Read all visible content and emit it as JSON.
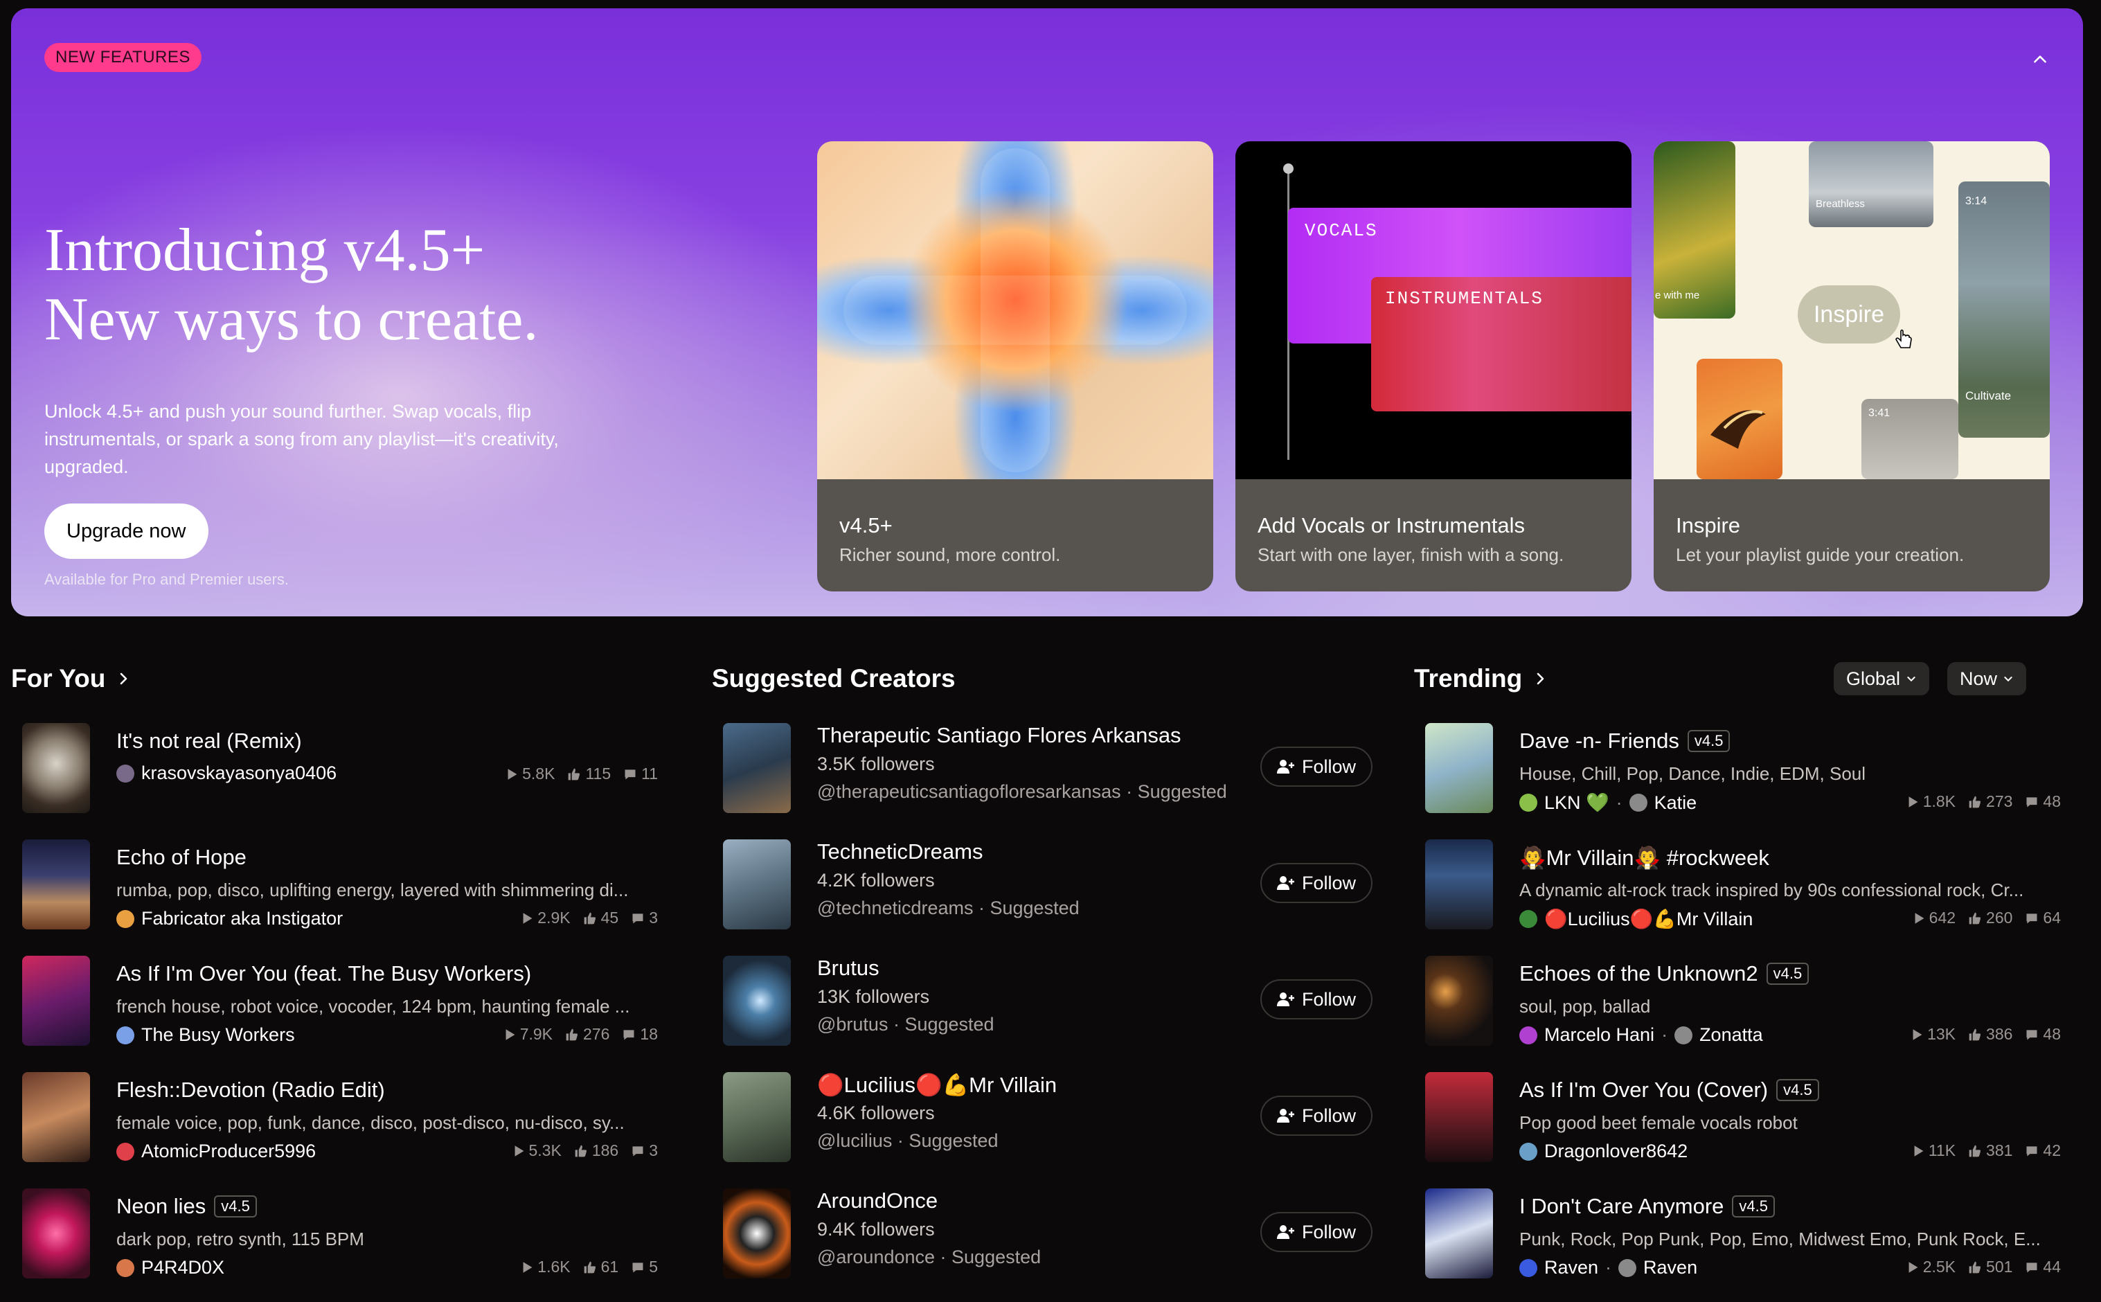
{
  "hero": {
    "badge": "NEW FEATURES",
    "title_line1": "Introducing v4.5+",
    "title_line2": "New ways to create.",
    "description": "Unlock 4.5+ and push your sound further. Swap vocals, flip instrumentals, or spark a song from any playlist—it's creativity, upgraded.",
    "cta": "Upgrade now",
    "note": "Available for Pro and Premier users.",
    "cards": [
      {
        "title": "v4.5+",
        "subtitle": "Richer sound, more control."
      },
      {
        "title": "Add Vocals or Instrumentals",
        "subtitle": "Start with one layer, finish with a song.",
        "label_vocals": "VOCALS",
        "label_instrumentals": "INSTRUMENTALS"
      },
      {
        "title": "Inspire",
        "subtitle": "Let your playlist guide your creation.",
        "pill": "Inspire",
        "tile_breathless": "Breathless",
        "tile_cultivate": "Cultivate",
        "tile_time1": "3:14",
        "tile_time2": "3:41",
        "tile_with_me": "e with me"
      }
    ]
  },
  "for_you": {
    "heading": "For You",
    "items": [
      {
        "title": "It's not real (Remix)",
        "author": "krasovskayasonya0406",
        "plays": "5.8K",
        "likes": "115",
        "comments": "11"
      },
      {
        "title": "Echo of Hope",
        "desc": "rumba, pop, disco, uplifting energy, layered with shimmering di...",
        "author": "Fabricator aka Instigator",
        "plays": "2.9K",
        "likes": "45",
        "comments": "3"
      },
      {
        "title": "As If I'm Over You (feat. The Busy Workers)",
        "desc": "french house, robot voice, vocoder, 124 bpm, haunting female ...",
        "author": "The Busy Workers",
        "plays": "7.9K",
        "likes": "276",
        "comments": "18"
      },
      {
        "title": "Flesh::Devotion (Radio Edit)",
        "desc": "female voice, pop, funk, dance, disco, post-disco, nu-disco, sy...",
        "author": "AtomicProducer5996",
        "plays": "5.3K",
        "likes": "186",
        "comments": "3"
      },
      {
        "title": "Neon lies",
        "badge": "v4.5",
        "desc": "dark pop, retro synth, 115 BPM",
        "author": "P4R4D0X",
        "plays": "1.6K",
        "likes": "61",
        "comments": "5"
      }
    ]
  },
  "suggested": {
    "heading": "Suggested Creators",
    "follow_label": "Follow",
    "items": [
      {
        "name": "Therapeutic Santiago Flores Arkansas",
        "followers": "3.5K followers",
        "handle": "@therapeuticsantiagofloresarkansas · Suggested"
      },
      {
        "name": "TechneticDreams",
        "followers": "4.2K followers",
        "handle": "@techneticdreams · Suggested"
      },
      {
        "name": "Brutus",
        "followers": "13K followers",
        "handle": "@brutus · Suggested"
      },
      {
        "name": "🔴Lucilius🔴💪Mr Villain",
        "followers": "4.6K followers",
        "handle": "@lucilius · Suggested"
      },
      {
        "name": "AroundOnce",
        "followers": "9.4K followers",
        "handle": "@aroundonce · Suggested"
      }
    ]
  },
  "trending": {
    "heading": "Trending",
    "filter_region": "Global",
    "filter_time": "Now",
    "items": [
      {
        "title": "Dave -n- Friends",
        "badge": "v4.5",
        "desc": "House, Chill, Pop, Dance, Indie, EDM, Soul",
        "author": "LKN 💚",
        "author2": "Katie",
        "plays": "1.8K",
        "likes": "273",
        "comments": "48"
      },
      {
        "title": "🧛Mr Villain🧛 #rockweek",
        "desc": "A dynamic alt-rock track inspired by 90s confessional rock, Cr...",
        "author": "🔴Lucilius🔴💪Mr Villain",
        "plays": "642",
        "likes": "260",
        "comments": "64"
      },
      {
        "title": "Echoes of the Unknown2",
        "badge": "v4.5",
        "desc": "soul, pop, ballad",
        "author": "Marcelo Hani",
        "author2": "Zonatta",
        "plays": "13K",
        "likes": "386",
        "comments": "48"
      },
      {
        "title": "As If I'm Over You (Cover)",
        "badge": "v4.5",
        "desc": "Pop good beet female vocals robot",
        "author": "Dragonlover8642",
        "plays": "11K",
        "likes": "381",
        "comments": "42"
      },
      {
        "title": "I Don't Care Anymore",
        "badge": "v4.5",
        "desc": "Punk, Rock, Pop Punk, Pop, Emo, Midwest Emo, Punk Rock, E...",
        "author": "Raven",
        "author2": "Raven",
        "plays": "2.5K",
        "likes": "501",
        "comments": "44"
      }
    ]
  },
  "colors": {
    "background": "#0c090b",
    "badge_pink": "#ff3b8d",
    "hero_purple": "#7a2fd9"
  }
}
